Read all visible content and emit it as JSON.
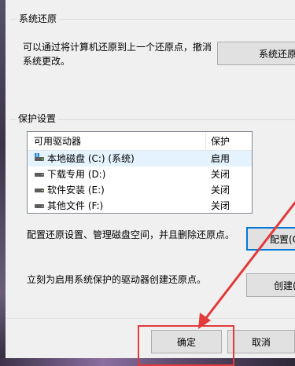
{
  "restore_group": {
    "title": "系统还原",
    "description_line1": "可以通过将计算机还原到上一个还原点，撤消",
    "description_line2": "系统更改。",
    "button_label": "系统还原..."
  },
  "protection_group": {
    "title": "保护设置",
    "columns": [
      "可用驱动器",
      "保护"
    ],
    "drives": [
      {
        "name": "本地磁盘 (C:) (系统)",
        "protection": "启用",
        "icon": "system-drive-icon"
      },
      {
        "name": "下载专用 (D:)",
        "protection": "关闭",
        "icon": "drive-icon"
      },
      {
        "name": "软件安装 (E:)",
        "protection": "关闭",
        "icon": "drive-icon"
      },
      {
        "name": "其他文件 (F:)",
        "protection": "关闭",
        "icon": "drive-icon"
      }
    ],
    "configure_text": "配置还原设置、管理磁盘空间，并且删除还原点。",
    "configure_button": "配置(O)...",
    "create_text": "立刻为启用系统保护的驱动器创建还原点。",
    "create_button": "创建(C)..."
  },
  "footer": {
    "ok_label": "确定",
    "cancel_label": "取消"
  },
  "annotation": {
    "highlight_color": "#e23a3a"
  }
}
